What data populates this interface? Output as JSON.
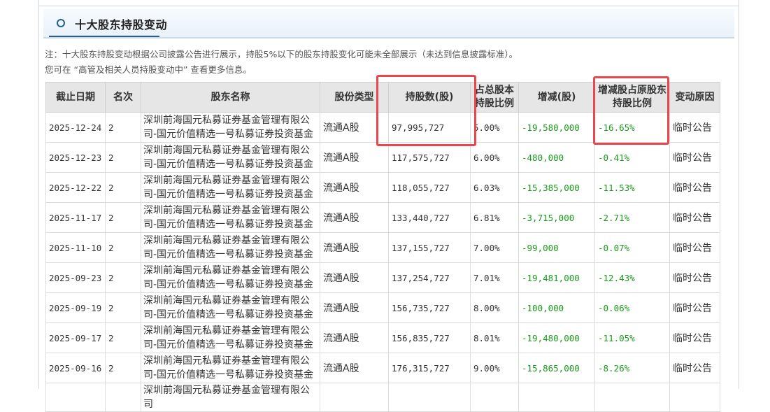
{
  "section": {
    "title": "十大股东持股变动",
    "icon": "circle-bullet-icon"
  },
  "notes": [
    "注：十大股东持股变动根据公司披露公告进行展示，持股5%以下的股东持股变化可能未全部展示（未达到信息披露标准）。",
    "您可在 “高管及相关人员持股变动中” 查看更多信息。"
  ],
  "table": {
    "columns": [
      {
        "key": "date",
        "label": "截止日期"
      },
      {
        "key": "rank",
        "label": "名次"
      },
      {
        "key": "holder",
        "label": "股东名称"
      },
      {
        "key": "share_type",
        "label": "股份类型"
      },
      {
        "key": "shares",
        "label": "持股数(股)"
      },
      {
        "key": "pct_total",
        "label": "占总股本持股比例"
      },
      {
        "key": "change",
        "label": "增减(股)"
      },
      {
        "key": "change_pct",
        "label": "增减股占原股东持股比例"
      },
      {
        "key": "reason",
        "label": "变动原因"
      }
    ],
    "rows": [
      {
        "date": "2025-12-24",
        "rank": "2",
        "holder": "深圳前海国元私募证券基金管理有限公司-国元价值精选一号私募证券投资基金",
        "share_type": "流通A股",
        "shares": "97,995,727",
        "pct_total": "5.00%",
        "change": "-19,580,000",
        "change_pct": "-16.65%",
        "reason": "临时公告"
      },
      {
        "date": "2025-12-23",
        "rank": "2",
        "holder": "深圳前海国元私募证券基金管理有限公司-国元价值精选一号私募证券投资基金",
        "share_type": "流通A股",
        "shares": "117,575,727",
        "pct_total": "6.00%",
        "change": "-480,000",
        "change_pct": "-0.41%",
        "reason": "临时公告"
      },
      {
        "date": "2025-12-22",
        "rank": "2",
        "holder": "深圳前海国元私募证券基金管理有限公司-国元价值精选一号私募证券投资基金",
        "share_type": "流通A股",
        "shares": "118,055,727",
        "pct_total": "6.03%",
        "change": "-15,385,000",
        "change_pct": "-11.53%",
        "reason": "临时公告"
      },
      {
        "date": "2025-11-17",
        "rank": "2",
        "holder": "深圳前海国元私募证券基金管理有限公司-国元价值精选一号私募证券投资基金",
        "share_type": "流通A股",
        "shares": "133,440,727",
        "pct_total": "6.81%",
        "change": "-3,715,000",
        "change_pct": "-2.71%",
        "reason": "临时公告"
      },
      {
        "date": "2025-11-10",
        "rank": "2",
        "holder": "深圳前海国元私募证券基金管理有限公司-国元价值精选一号私募证券投资基金",
        "share_type": "流通A股",
        "shares": "137,155,727",
        "pct_total": "7.00%",
        "change": "-99,000",
        "change_pct": "-0.07%",
        "reason": "临时公告"
      },
      {
        "date": "2025-09-23",
        "rank": "2",
        "holder": "深圳前海国元私募证券基金管理有限公司-国元价值精选一号私募证券投资基金",
        "share_type": "流通A股",
        "shares": "137,254,727",
        "pct_total": "7.01%",
        "change": "-19,481,000",
        "change_pct": "-12.43%",
        "reason": "临时公告"
      },
      {
        "date": "2025-09-19",
        "rank": "2",
        "holder": "深圳前海国元私募证券基金管理有限公司-国元价值精选一号私募证券投资基金",
        "share_type": "流通A股",
        "shares": "156,735,727",
        "pct_total": "8.00%",
        "change": "-100,000",
        "change_pct": "-0.06%",
        "reason": "临时公告"
      },
      {
        "date": "2025-09-17",
        "rank": "2",
        "holder": "深圳前海国元私募证券基金管理有限公司-国元价值精选一号私募证券投资基金",
        "share_type": "流通A股",
        "shares": "156,835,727",
        "pct_total": "8.01%",
        "change": "-19,480,000",
        "change_pct": "-11.05%",
        "reason": "临时公告"
      },
      {
        "date": "2025-09-16",
        "rank": "2",
        "holder": "深圳前海国元私募证券基金管理有限公司-国元价值精选一号私募证券投资基金",
        "share_type": "流通A股",
        "shares": "176,315,727",
        "pct_total": "9.00%",
        "change": "-15,865,000",
        "change_pct": "-8.26%",
        "reason": "临时公告"
      }
    ],
    "partial_row_holder": "深圳前海国元私募证券基金管理有限公司"
  },
  "colors": {
    "highlight": "#e8474f",
    "negative": "#1a9a1a",
    "header_bg": "#e6e6e6"
  }
}
